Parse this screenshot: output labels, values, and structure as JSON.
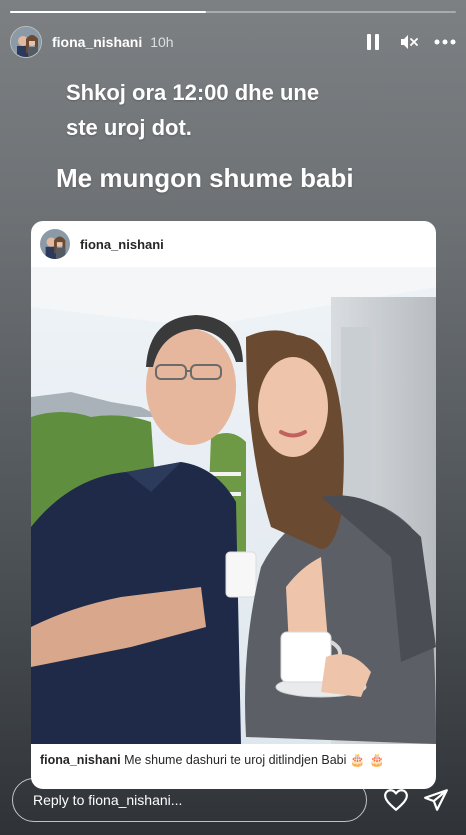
{
  "story": {
    "progress": 0.44,
    "username": "fiona_nishani",
    "time_ago": "10h",
    "icons": [
      "pause-icon",
      "mute-icon",
      "more-icon"
    ]
  },
  "caption": {
    "line1": "Shkoj ora 12:00 dhe une",
    "line2": "ste uroj dot.",
    "line3": "Me mungon shume babi"
  },
  "shared_post": {
    "username": "fiona_nishani",
    "caption_user": "fiona_nishani",
    "caption_text": "Me shume dashuri te uroj ditlindjen Babi",
    "caption_emoji": "🎂 🎂"
  },
  "reply": {
    "placeholder": "Reply to fiona_nishani..."
  },
  "colors": {
    "background_top": "#7d8083",
    "background_bottom": "#2f3337",
    "text": "#ffffff"
  }
}
